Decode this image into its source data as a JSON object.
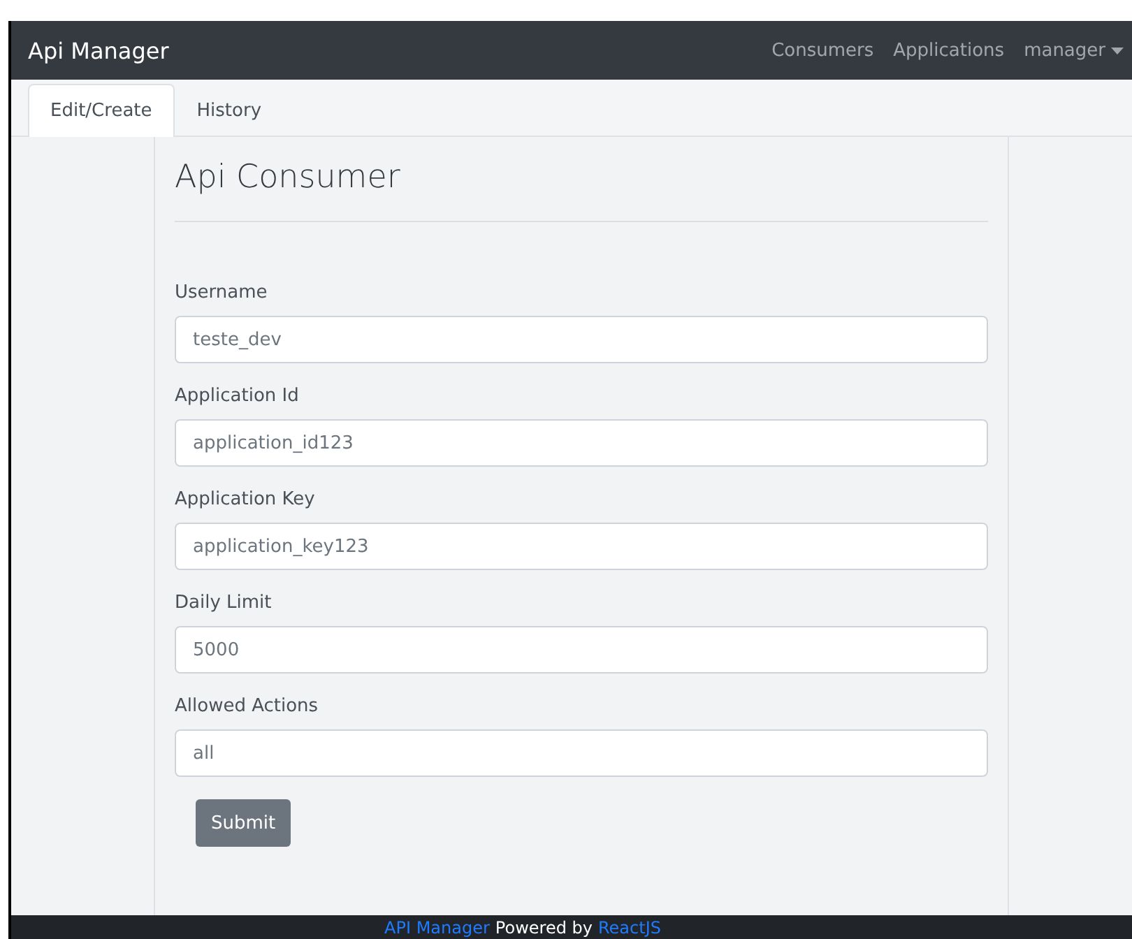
{
  "navbar": {
    "brand": "Api Manager",
    "links": [
      {
        "label": "Consumers",
        "kind": "link"
      },
      {
        "label": "Applications",
        "kind": "link"
      },
      {
        "label": "manager",
        "kind": "dropdown"
      }
    ]
  },
  "tabs": [
    {
      "label": "Edit/Create",
      "selected": true
    },
    {
      "label": "History",
      "selected": false
    }
  ],
  "form": {
    "title": "Api Consumer",
    "fields": [
      {
        "label": "Username",
        "value": "teste_dev"
      },
      {
        "label": "Application Id",
        "value": "application_id123"
      },
      {
        "label": "Application Key",
        "value": "application_key123"
      },
      {
        "label": "Daily Limit",
        "value": "5000"
      },
      {
        "label": "Allowed Actions",
        "value": "all"
      }
    ],
    "submit": "Submit"
  },
  "footer": {
    "app_link": "API Manager",
    "text": "Powered by",
    "framework_link": "ReactJS"
  }
}
